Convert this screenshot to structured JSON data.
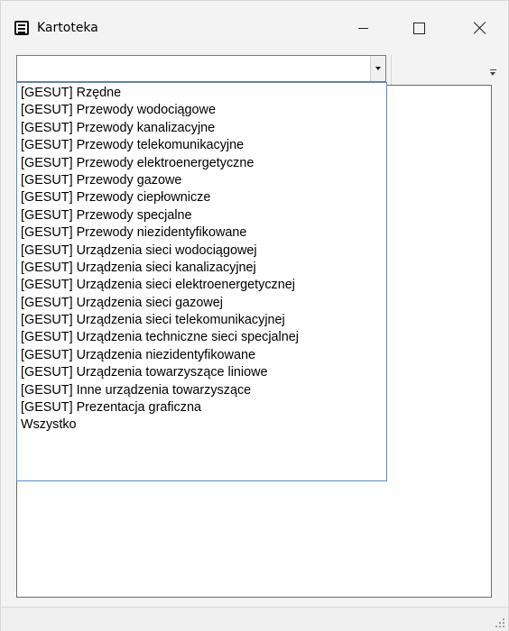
{
  "window": {
    "title": "Kartoteka"
  },
  "combo": {
    "value": ""
  },
  "dropdown": {
    "items": [
      "[GESUT] Rzędne",
      "[GESUT] Przewody wodociągowe",
      "[GESUT] Przewody kanalizacyjne",
      "[GESUT] Przewody telekomunikacyjne",
      "[GESUT] Przewody elektroenergetyczne",
      "[GESUT] Przewody gazowe",
      "[GESUT] Przewody ciepłownicze",
      "[GESUT] Przewody specjalne",
      "[GESUT] Przewody niezidentyfikowane",
      "[GESUT] Urządzenia sieci wodociągowej",
      "[GESUT] Urządzenia sieci kanalizacyjnej",
      "[GESUT] Urządzenia sieci elektroenergetycznej",
      "[GESUT] Urządzenia sieci gazowej",
      "[GESUT] Urządzenia sieci telekomunikacyjnej",
      "[GESUT] Urządzenia techniczne sieci specjalnej",
      "[GESUT] Urządzenia niezidentyfikowane",
      "[GESUT] Urządzenia towarzyszące liniowe",
      "[GESUT] Inne urządzenia towarzyszące",
      "[GESUT] Prezentacja graficzna",
      "Wszystko"
    ]
  },
  "icons": {
    "app": "card-file-icon",
    "minimize": "minimize-icon",
    "maximize": "maximize-icon",
    "close": "close-icon",
    "dropdown": "chevron-down-icon",
    "overflow": "toolbar-overflow-icon",
    "grip": "resize-grip-icon"
  }
}
